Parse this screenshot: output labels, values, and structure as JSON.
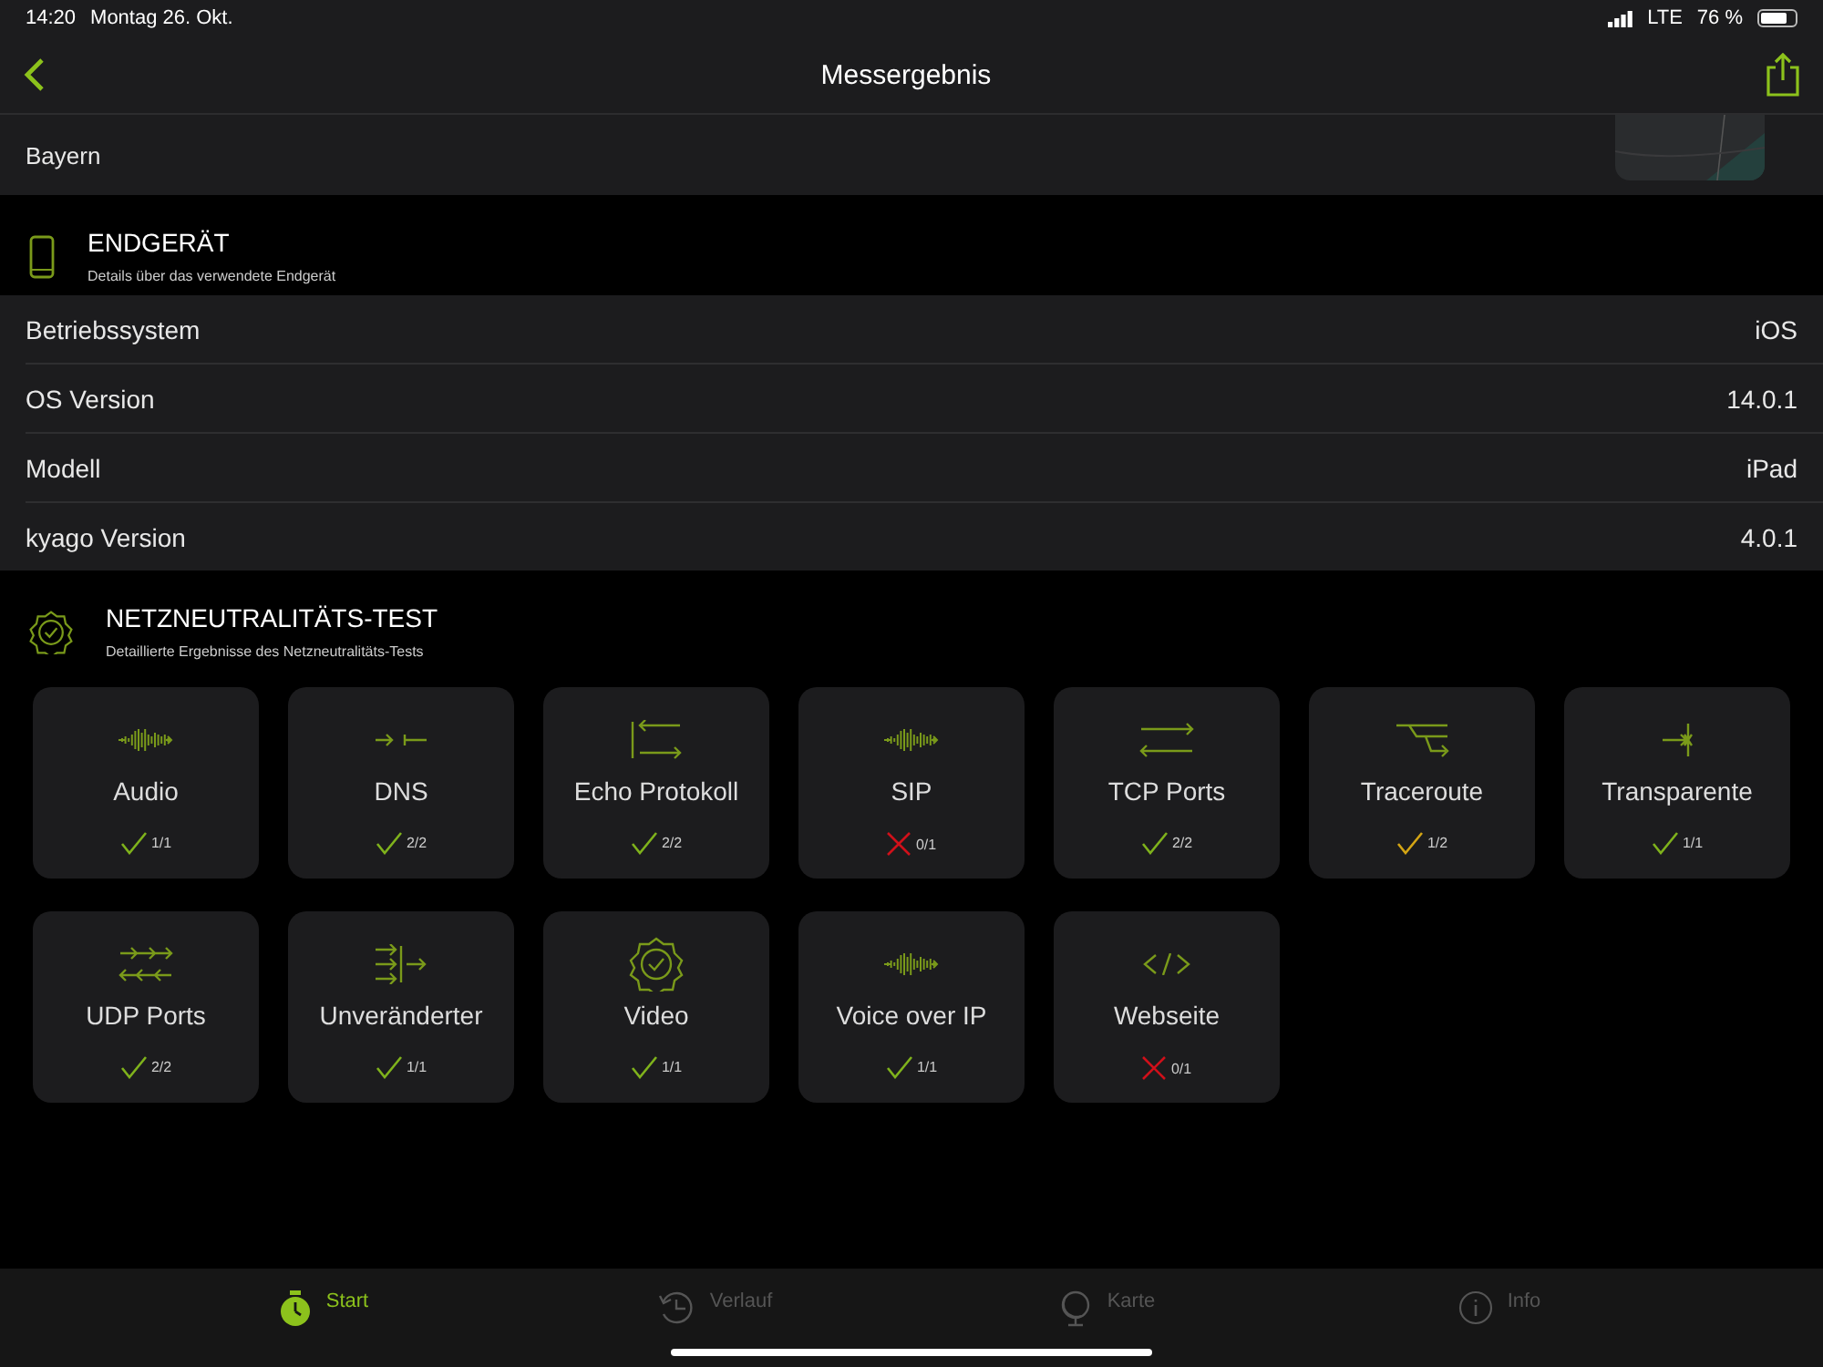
{
  "status_bar": {
    "time": "14:20",
    "date": "Montag 26. Okt.",
    "network": "LTE",
    "battery": "76 %"
  },
  "nav": {
    "title": "Messergebnis"
  },
  "location": {
    "region": "Bayern"
  },
  "device_section": {
    "title": "ENDGERÄT",
    "subtitle": "Details über das verwendete Endgerät",
    "rows": [
      {
        "label": "Betriebssystem",
        "value": "iOS"
      },
      {
        "label": "OS Version",
        "value": "14.0.1"
      },
      {
        "label": "Modell",
        "value": "iPad"
      },
      {
        "label": "kyago Version",
        "value": "4.0.1"
      }
    ]
  },
  "test_section": {
    "title": "NETZNEUTRALITÄTS-TEST",
    "subtitle": "Detaillierte Ergebnisse des Netzneutralitäts-Tests",
    "tiles": [
      {
        "label": "Audio",
        "kind": "wave",
        "passed": true,
        "color": "#7fb21c",
        "result": "1/1"
      },
      {
        "label": "DNS",
        "kind": "dns",
        "passed": true,
        "color": "#7fb21c",
        "result": "2/2"
      },
      {
        "label": "Echo Protokoll",
        "kind": "echo",
        "passed": true,
        "color": "#7fb21c",
        "result": "2/2"
      },
      {
        "label": "SIP",
        "kind": "wave",
        "passed": false,
        "color": "#d0101a",
        "result": "0/1"
      },
      {
        "label": "TCP Ports",
        "kind": "tcp",
        "passed": true,
        "color": "#7fb21c",
        "result": "2/2"
      },
      {
        "label": "Traceroute",
        "kind": "trace",
        "passed": true,
        "color": "#d4a514",
        "result": "1/2"
      },
      {
        "label": "Transparente",
        "kind": "transparent",
        "passed": true,
        "color": "#7fb21c",
        "result": "1/1"
      },
      {
        "label": "UDP Ports",
        "kind": "udp",
        "passed": true,
        "color": "#7fb21c",
        "result": "2/2"
      },
      {
        "label": "Unveränderter",
        "kind": "unchanged",
        "passed": true,
        "color": "#7fb21c",
        "result": "1/1"
      },
      {
        "label": "Video",
        "kind": "badge",
        "passed": true,
        "color": "#7fb21c",
        "result": "1/1"
      },
      {
        "label": "Voice over IP",
        "kind": "wave",
        "passed": true,
        "color": "#7fb21c",
        "result": "1/1"
      },
      {
        "label": "Webseite",
        "kind": "code",
        "passed": false,
        "color": "#d0101a",
        "result": "0/1"
      }
    ]
  },
  "tab_bar": [
    {
      "label": "Start",
      "kind": "stopwatch",
      "selected": true
    },
    {
      "label": "Verlauf",
      "kind": "history",
      "selected": false
    },
    {
      "label": "Karte",
      "kind": "globe",
      "selected": false
    },
    {
      "label": "Info",
      "kind": "info",
      "selected": false
    }
  ]
}
